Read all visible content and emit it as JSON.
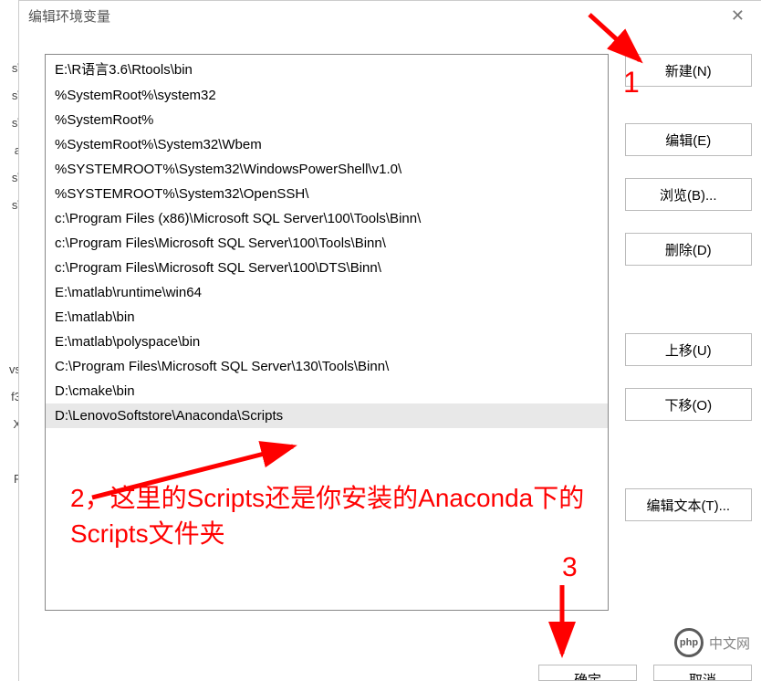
{
  "background_fragments": [
    "s\\",
    "s\\",
    "s\\",
    "a",
    "s\\",
    "s\\",
    "",
    "",
    "",
    "",
    "",
    "vs",
    "f3",
    "X",
    "",
    "F"
  ],
  "dialog": {
    "title": "编辑环境变量"
  },
  "path_items": [
    "E:\\R语言3.6\\Rtools\\bin",
    "%SystemRoot%\\system32",
    "%SystemRoot%",
    "%SystemRoot%\\System32\\Wbem",
    "%SYSTEMROOT%\\System32\\WindowsPowerShell\\v1.0\\",
    "%SYSTEMROOT%\\System32\\OpenSSH\\",
    "c:\\Program Files (x86)\\Microsoft SQL Server\\100\\Tools\\Binn\\",
    "c:\\Program Files\\Microsoft SQL Server\\100\\Tools\\Binn\\",
    "c:\\Program Files\\Microsoft SQL Server\\100\\DTS\\Binn\\",
    "E:\\matlab\\runtime\\win64",
    "E:\\matlab\\bin",
    "E:\\matlab\\polyspace\\bin",
    "C:\\Program Files\\Microsoft SQL Server\\130\\Tools\\Binn\\",
    "D:\\cmake\\bin",
    "D:\\LenovoSoftstore\\Anaconda\\Scripts"
  ],
  "selected_index": 14,
  "buttons": {
    "new": "新建(N)",
    "edit": "编辑(E)",
    "browse": "浏览(B)...",
    "delete": "删除(D)",
    "moveup": "上移(U)",
    "movedown": "下移(O)",
    "edittext": "编辑文本(T)...",
    "ok": "确定",
    "cancel": "取消"
  },
  "annotations": {
    "a1": "1",
    "a2": "2，这里的Scripts还是你安装的Anaconda下的Scripts文件夹",
    "a3": "3"
  },
  "watermark": {
    "logo": "php",
    "text": "中文网"
  }
}
